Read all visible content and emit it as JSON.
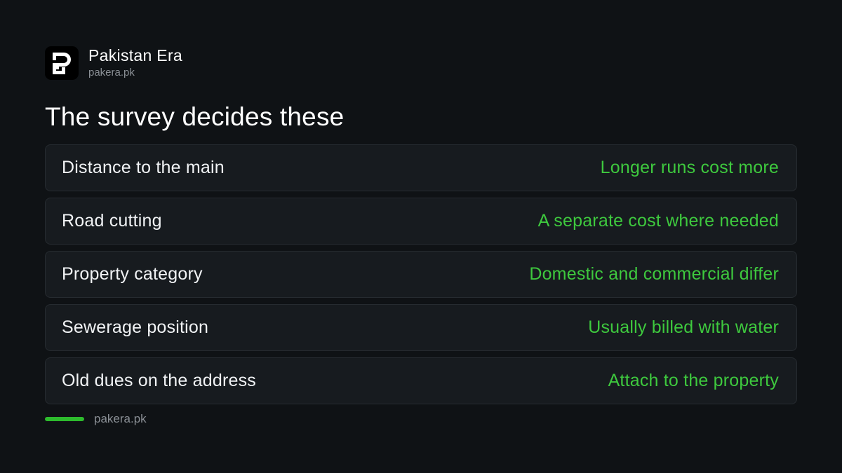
{
  "brand": {
    "name": "Pakistan Era",
    "url": "pakera.pk",
    "logo_icon": "pakera-logo-icon"
  },
  "title": "The survey decides these",
  "rows": [
    {
      "label": "Distance to the main",
      "value": "Longer runs cost more"
    },
    {
      "label": "Road cutting",
      "value": "A separate cost where needed"
    },
    {
      "label": "Property category",
      "value": "Domestic and commercial differ"
    },
    {
      "label": "Sewerage position",
      "value": "Usually billed with water"
    },
    {
      "label": "Old dues on the address",
      "value": "Attach to the property"
    }
  ],
  "footer": {
    "url": "pakera.pk"
  },
  "colors": {
    "background": "#0f1215",
    "card": "#171b1f",
    "accent": "#3ec93e",
    "muted": "#8a8f95"
  }
}
